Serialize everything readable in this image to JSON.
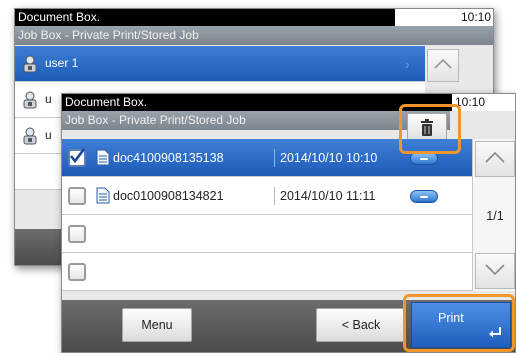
{
  "back_screen": {
    "title": "Document Box.",
    "time": "10:10",
    "subtitle": "Job Box - Private Print/Stored Job",
    "rows": [
      {
        "label": "user 1",
        "selected": true
      },
      {
        "label": "u",
        "selected": false
      },
      {
        "label": "u",
        "selected": false
      }
    ],
    "scroll_up_icon": "chevron-up-icon"
  },
  "front_screen": {
    "title": "Document Box.",
    "time": "10:10",
    "subtitle": "Job Box - Private Print/Stored Job",
    "delete_icon": "trash-icon",
    "rows": [
      {
        "name": "doc4100908135138",
        "date": "2014/10/10 10:10",
        "checked": true,
        "selected": true
      },
      {
        "name": "doc0100908134821",
        "date": "2014/10/10 11:11",
        "checked": false,
        "selected": false
      },
      {
        "name": "",
        "date": "",
        "checked": false,
        "selected": false
      },
      {
        "name": "",
        "date": "",
        "checked": false,
        "selected": false
      }
    ],
    "page_indicator": "1/1",
    "buttons": {
      "menu": "Menu",
      "back": "< Back",
      "print": "Print"
    }
  },
  "colors": {
    "selection_blue": "#1d5bb8",
    "highlight_orange": "#f0962c",
    "title_black": "#000000"
  }
}
